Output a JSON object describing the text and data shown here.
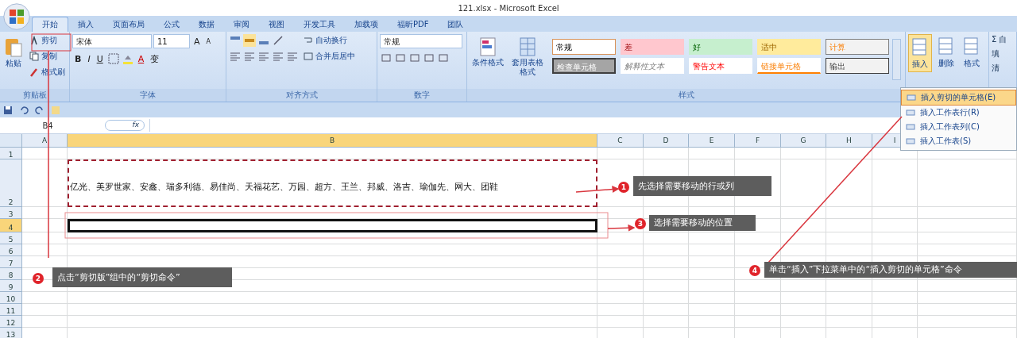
{
  "window": {
    "title": "121.xlsx - Microsoft Excel"
  },
  "tabs": [
    {
      "label": "开始",
      "selected": true
    },
    {
      "label": "插入",
      "selected": false
    },
    {
      "label": "页面布局",
      "selected": false
    },
    {
      "label": "公式",
      "selected": false
    },
    {
      "label": "数据",
      "selected": false
    },
    {
      "label": "审阅",
      "selected": false
    },
    {
      "label": "视图",
      "selected": false
    },
    {
      "label": "开发工具",
      "selected": false
    },
    {
      "label": "加载项",
      "selected": false
    },
    {
      "label": "福昕PDF",
      "selected": false
    },
    {
      "label": "团队",
      "selected": false
    }
  ],
  "clipboard": {
    "paste": "粘贴",
    "cut": "剪切",
    "copy": "复制",
    "painter": "格式刷",
    "group": "剪贴板"
  },
  "font": {
    "name": "宋体",
    "size": "11",
    "bold": "B",
    "italic": "I",
    "underline": "U",
    "color_letter": "A",
    "phonetic": "变",
    "grow": "A",
    "shrink": "A",
    "group": "字体"
  },
  "alignment": {
    "wrap": "自动换行",
    "merge": "合并后居中",
    "group": "对齐方式"
  },
  "number": {
    "format": "常规",
    "group": "数字"
  },
  "styles": {
    "conditional": "条件格式",
    "table": "套用表格格式",
    "group": "样式",
    "items": [
      {
        "label": "常规",
        "kind": "normal"
      },
      {
        "label": "差",
        "kind": "bad"
      },
      {
        "label": "好",
        "kind": "good"
      },
      {
        "label": "适中",
        "kind": "neutral"
      },
      {
        "label": "计算",
        "kind": "calc"
      },
      {
        "label": "检查单元格",
        "kind": "check"
      },
      {
        "label": "解释性文本",
        "kind": "explanatory"
      },
      {
        "label": "警告文本",
        "kind": "warning"
      },
      {
        "label": "链接单元格",
        "kind": "linked"
      },
      {
        "label": "输出",
        "kind": "output"
      }
    ]
  },
  "cells": {
    "buttons": [
      {
        "label": "插入",
        "selected": true
      },
      {
        "label": "删除",
        "selected": false
      },
      {
        "label": "格式",
        "selected": false
      }
    ]
  },
  "editing": {
    "items": [
      "Σ 自",
      "填",
      "清"
    ]
  },
  "insert_menu": [
    {
      "label": "插入剪切的单元格(E)",
      "selected": true
    },
    {
      "label": "插入工作表行(R)",
      "selected": false
    },
    {
      "label": "插入工作表列(C)",
      "selected": false
    },
    {
      "label": "插入工作表(S)",
      "selected": false
    }
  ],
  "formula_bar": {
    "name_box": "B4",
    "fx": "fx"
  },
  "sheet": {
    "columns": [
      {
        "label": "A",
        "selected": false
      },
      {
        "label": "B",
        "selected": true
      },
      {
        "label": "C",
        "selected": false
      },
      {
        "label": "D",
        "selected": false
      },
      {
        "label": "E",
        "selected": false
      },
      {
        "label": "F",
        "selected": false
      },
      {
        "label": "G",
        "selected": false
      },
      {
        "label": "H",
        "selected": false
      },
      {
        "label": "I",
        "selected": false
      }
    ],
    "rows": [
      {
        "label": "1",
        "selected": false,
        "cut": false
      },
      {
        "label": "2",
        "selected": false,
        "cut": true,
        "b_text": "亿光、美罗世家、安鑫、瑞多利德、易佳尚、天福花艺、万园、超方、王兰、邦威、洛吉、瑜伽先、网大、团鞋"
      },
      {
        "label": "3",
        "selected": false,
        "cut": false
      },
      {
        "label": "4",
        "selected": true,
        "cut": false
      },
      {
        "label": "5",
        "selected": false,
        "cut": false
      },
      {
        "label": "6",
        "selected": false,
        "cut": false
      },
      {
        "label": "7",
        "selected": false,
        "cut": false
      },
      {
        "label": "8",
        "selected": false,
        "cut": false
      },
      {
        "label": "9",
        "selected": false,
        "cut": false
      },
      {
        "label": "10",
        "selected": false,
        "cut": false
      },
      {
        "label": "11",
        "selected": false,
        "cut": false
      },
      {
        "label": "12",
        "selected": false,
        "cut": false
      },
      {
        "label": "13",
        "selected": false,
        "cut": false
      }
    ]
  },
  "callouts": [
    {
      "number": "1",
      "text": "先选择需要移动的行或列"
    },
    {
      "number": "2",
      "text": "点击“剪切版”组中的“剪切命令”"
    },
    {
      "number": "3",
      "text": "选择需要移动的位置"
    },
    {
      "number": "4",
      "text": "单击“插入”下拉菜单中的“插入剪切的单元格”命令"
    }
  ]
}
